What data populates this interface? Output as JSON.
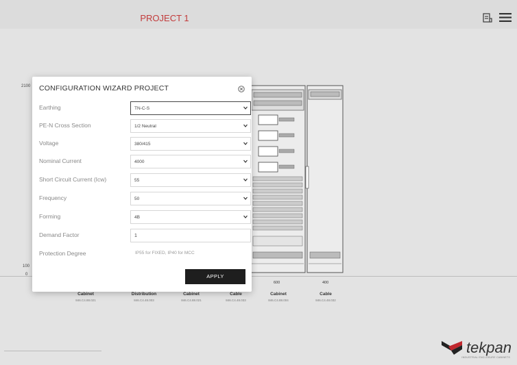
{
  "header": {
    "title": "PROJECT 1",
    "icons": [
      "document-list-icon",
      "hamburger-menu-icon"
    ]
  },
  "drawing": {
    "scale_top": "2100",
    "scale_mid": "100",
    "scale_zero": "0",
    "dims": [
      "600",
      "400"
    ],
    "cabinets": [
      {
        "name": "Cabinet",
        "code": "846.C4.88.021"
      },
      {
        "name": "Distribution",
        "code": "846.C4.48.003"
      },
      {
        "name": "Cabinet",
        "code": "846.C4.88.021"
      },
      {
        "name": "Cable",
        "code": "846.C4.48.033"
      },
      {
        "name": "Cabinet",
        "code": "846.C4.88.004"
      },
      {
        "name": "Cable",
        "code": "846.C4.48.032"
      }
    ]
  },
  "modal": {
    "title": "CONFIGURATION WIZARD PROJECT",
    "fields": [
      {
        "label": "Earthing",
        "value": "TN-C-S"
      },
      {
        "label": "PE-N Cross Section",
        "value": "1/2 Neutral"
      },
      {
        "label": "Voltage",
        "value": "380/415"
      },
      {
        "label": "Nominal Current",
        "value": "4000"
      },
      {
        "label": "Short Circuit Current (Icw)",
        "value": "55"
      },
      {
        "label": "Frequency",
        "value": "50"
      },
      {
        "label": "Forming",
        "value": "4B"
      },
      {
        "label": "Demand Factor",
        "value": "1"
      },
      {
        "label": "Protection Degree",
        "value": "IP55 for FIXED, IP40 for MCC"
      }
    ],
    "apply_label": "APPLY"
  },
  "brand": {
    "name": "tekpan",
    "tagline": "INDUSTRIAL ENCLOSURE CABINETS",
    "accent_color": "#c0272d"
  }
}
